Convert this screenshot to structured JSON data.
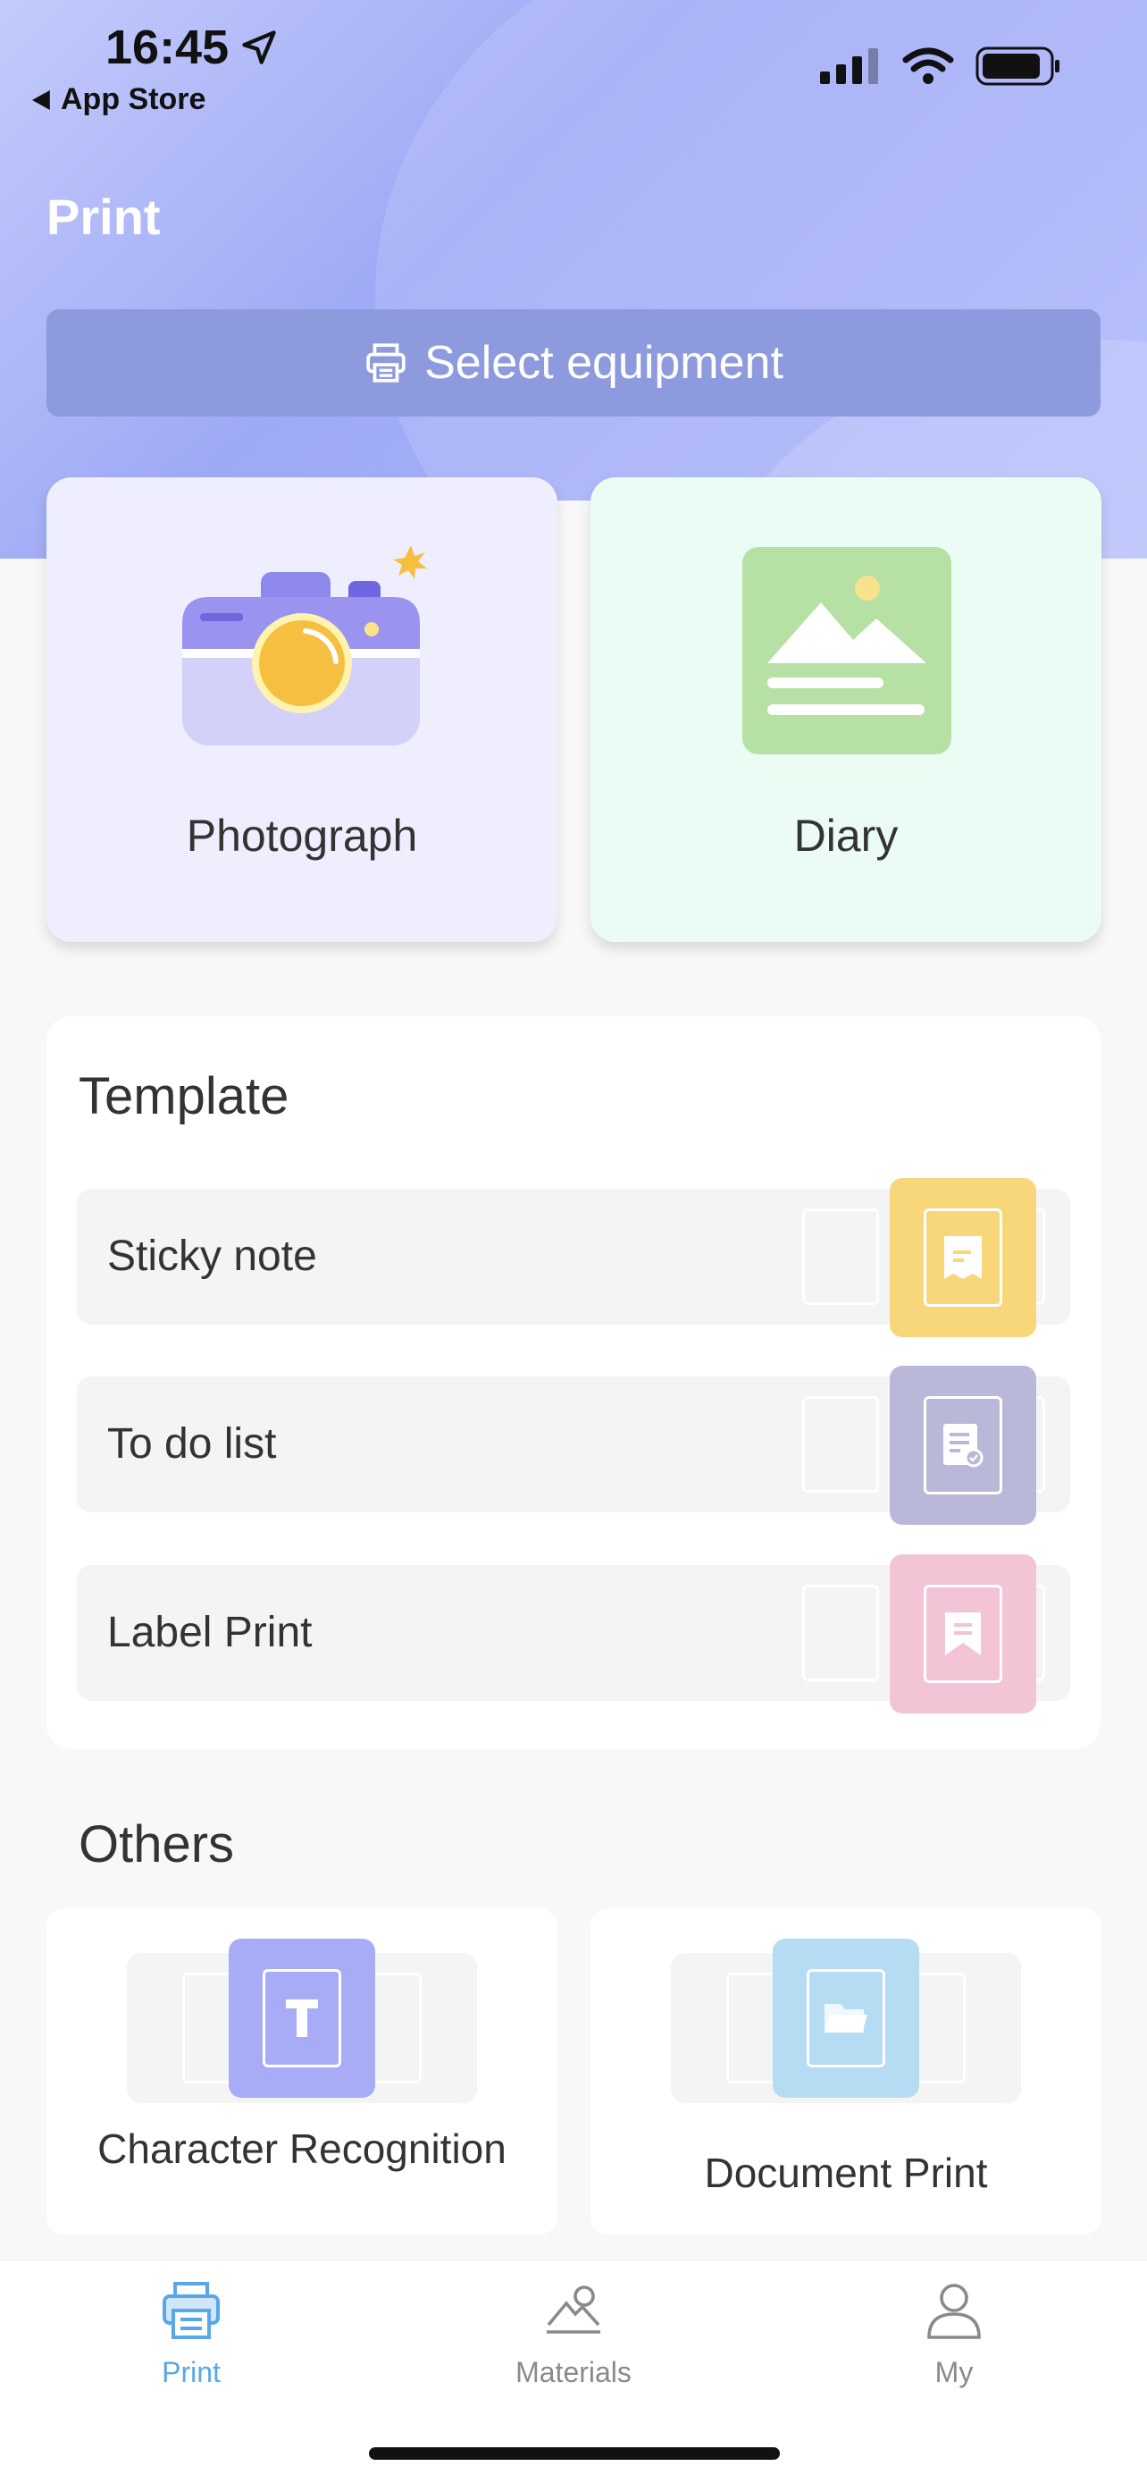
{
  "status_bar": {
    "time": "16:45",
    "back_label": "App Store"
  },
  "header": {
    "title": "Print",
    "select_equipment": "Select equipment"
  },
  "main_cards": [
    {
      "label": "Photograph",
      "icon": "camera-icon",
      "bg": "#efeefe"
    },
    {
      "label": "Diary",
      "icon": "image-document-icon",
      "bg": "#eafcf4"
    }
  ],
  "template": {
    "title": "Template",
    "items": [
      {
        "label": "Sticky note",
        "color": "#f8d77a",
        "icon": "sticky-note-icon"
      },
      {
        "label": "To do list",
        "color": "#bab8d9",
        "icon": "todo-list-icon"
      },
      {
        "label": "Label Print",
        "color": "#f3c3d6",
        "icon": "label-icon"
      }
    ]
  },
  "others": {
    "title": "Others",
    "items": [
      {
        "label": "Character Recognition",
        "color": "#a8acf7",
        "icon": "text-recognition-icon"
      },
      {
        "label": "Document Print",
        "color": "#b6dcf3",
        "icon": "folder-icon"
      }
    ]
  },
  "tabbar": {
    "items": [
      {
        "label": "Print",
        "active": true,
        "icon": "printer-icon"
      },
      {
        "label": "Materials",
        "active": false,
        "icon": "landscape-icon"
      },
      {
        "label": "My",
        "active": false,
        "icon": "user-icon"
      }
    ],
    "active_color": "#5aa7e8",
    "inactive_color": "#8a8a8a"
  }
}
